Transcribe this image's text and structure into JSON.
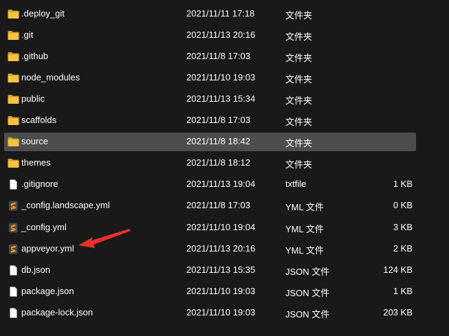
{
  "files": [
    {
      "name": ".deploy_git",
      "date": "2021/11/11 17:18",
      "type": "文件夹",
      "size": "",
      "icon": "folder-icon"
    },
    {
      "name": ".git",
      "date": "2021/11/13 20:16",
      "type": "文件夹",
      "size": "",
      "icon": "folder-icon"
    },
    {
      "name": ".github",
      "date": "2021/11/8 17:03",
      "type": "文件夹",
      "size": "",
      "icon": "folder-icon"
    },
    {
      "name": "node_modules",
      "date": "2021/11/10 19:03",
      "type": "文件夹",
      "size": "",
      "icon": "folder-icon"
    },
    {
      "name": "public",
      "date": "2021/11/13 15:34",
      "type": "文件夹",
      "size": "",
      "icon": "folder-icon"
    },
    {
      "name": "scaffolds",
      "date": "2021/11/8 17:03",
      "type": "文件夹",
      "size": "",
      "icon": "folder-icon"
    },
    {
      "name": "source",
      "date": "2021/11/8 18:42",
      "type": "文件夹",
      "size": "",
      "icon": "folder-icon",
      "selected": true
    },
    {
      "name": "themes",
      "date": "2021/11/8 18:12",
      "type": "文件夹",
      "size": "",
      "icon": "folder-icon"
    },
    {
      "name": ".gitignore",
      "date": "2021/11/13 19:04",
      "type": "txtfile",
      "size": "1 KB",
      "icon": "document-icon"
    },
    {
      "name": "_config.landscape.yml",
      "date": "2021/11/8 17:03",
      "type": "YML 文件",
      "size": "0 KB",
      "icon": "sublime-text-icon"
    },
    {
      "name": "_config.yml",
      "date": "2021/11/10 19:04",
      "type": "YML 文件",
      "size": "3 KB",
      "icon": "sublime-text-icon"
    },
    {
      "name": "appveyor.yml",
      "date": "2021/11/13 20:16",
      "type": "YML 文件",
      "size": "2 KB",
      "icon": "sublime-text-icon"
    },
    {
      "name": "db.json",
      "date": "2021/11/13 15:35",
      "type": "JSON 文件",
      "size": "124 KB",
      "icon": "document-icon"
    },
    {
      "name": "package.json",
      "date": "2021/11/10 19:03",
      "type": "JSON 文件",
      "size": "1 KB",
      "icon": "document-icon"
    },
    {
      "name": "package-lock.json",
      "date": "2021/11/10 19:03",
      "type": "JSON 文件",
      "size": "203 KB",
      "icon": "document-icon"
    }
  ],
  "colors": {
    "background": "#191919",
    "selected_row": "#4d4d4d",
    "text": "#ffffff",
    "folder": "#f5c242",
    "sublime": "#f79a1e",
    "annotation_arrow": "#e8302a"
  }
}
